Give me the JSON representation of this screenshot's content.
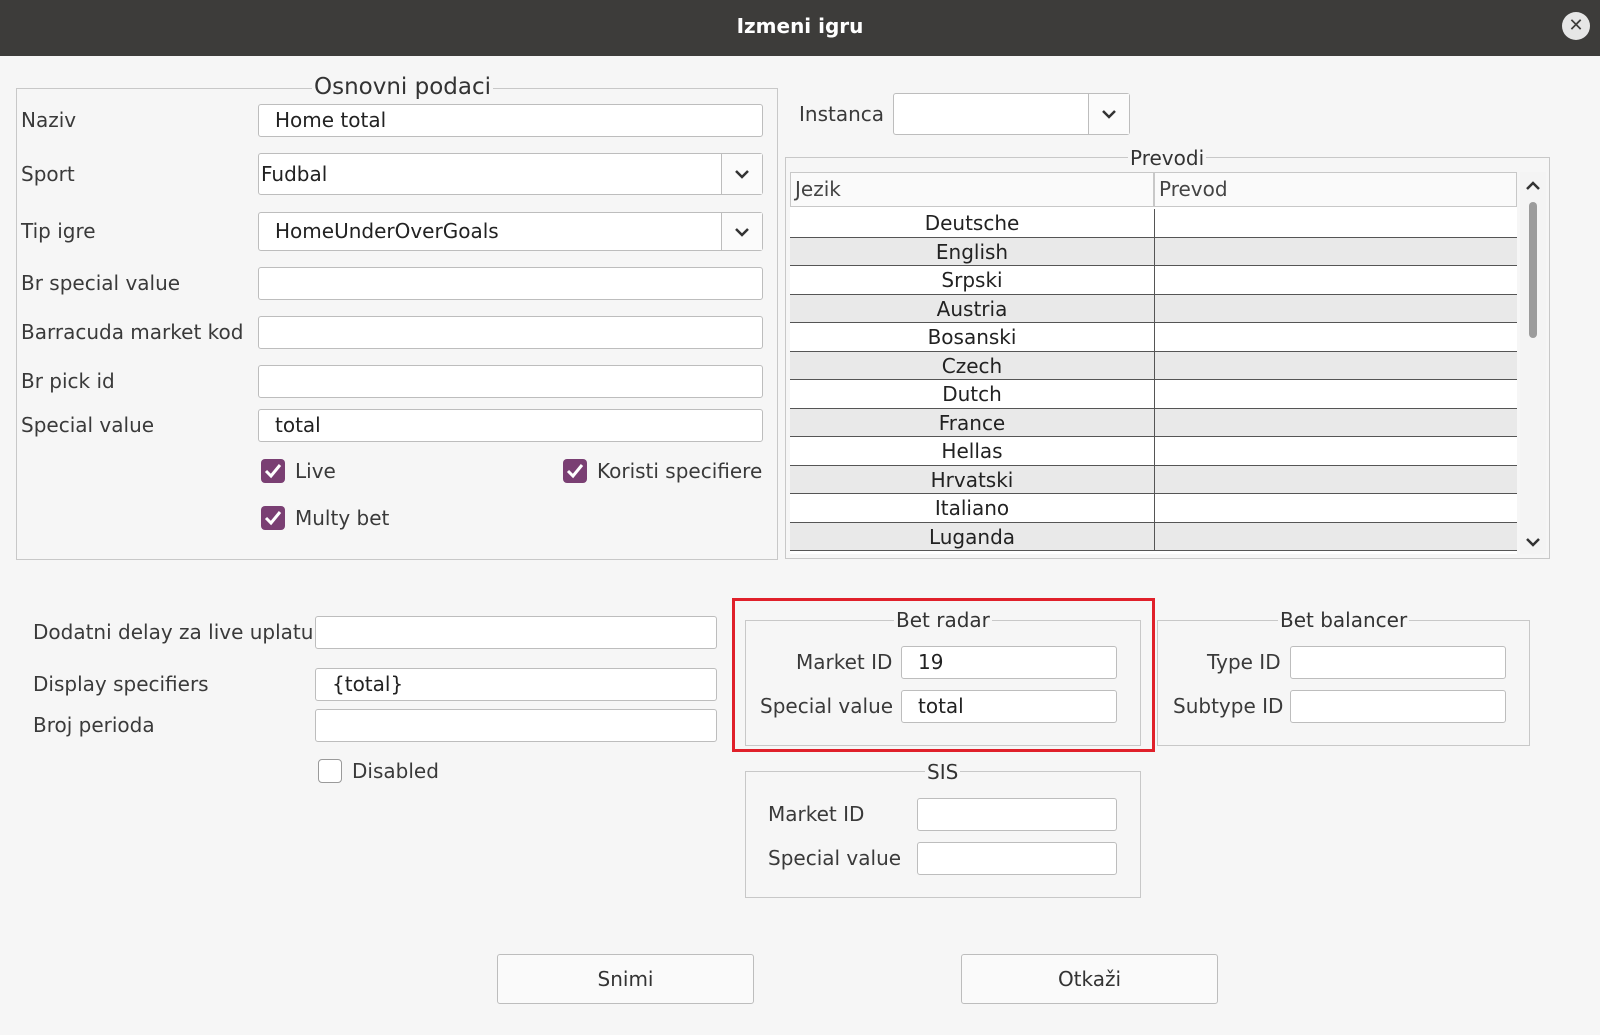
{
  "window": {
    "title": "Izmeni igru",
    "close_icon": "close-icon"
  },
  "basic": {
    "legend": "Osnovni podaci",
    "naziv": {
      "label": "Naziv",
      "value": "Home total"
    },
    "sport": {
      "label": "Sport",
      "value": "Fudbal"
    },
    "tip_igre": {
      "label": "Tip igre",
      "value": "HomeUnderOverGoals"
    },
    "br_special_value": {
      "label": "Br special value",
      "value": ""
    },
    "barracuda_market_kod": {
      "label": "Barracuda market kod",
      "value": ""
    },
    "br_pick_id": {
      "label": "Br pick id",
      "value": ""
    },
    "special_value": {
      "label": "Special value",
      "value": "total"
    },
    "live": {
      "label": "Live",
      "checked": true
    },
    "koristi_specifiere": {
      "label": "Koristi specifiere",
      "checked": true
    },
    "multy_bet": {
      "label": "Multy bet",
      "checked": true
    }
  },
  "instanca": {
    "label": "Instanca",
    "value": ""
  },
  "prevodi": {
    "legend": "Prevodi",
    "columns": [
      "Jezik",
      "Prevod"
    ],
    "rows": [
      {
        "jezik": "Deutsche",
        "prevod": ""
      },
      {
        "jezik": "English",
        "prevod": ""
      },
      {
        "jezik": "Srpski",
        "prevod": ""
      },
      {
        "jezik": "Austria",
        "prevod": ""
      },
      {
        "jezik": "Bosanski",
        "prevod": ""
      },
      {
        "jezik": "Czech",
        "prevod": ""
      },
      {
        "jezik": "Dutch",
        "prevod": ""
      },
      {
        "jezik": "France",
        "prevod": ""
      },
      {
        "jezik": "Hellas",
        "prevod": ""
      },
      {
        "jezik": "Hrvatski",
        "prevod": ""
      },
      {
        "jezik": "Italiano",
        "prevod": ""
      },
      {
        "jezik": "Luganda",
        "prevod": ""
      }
    ]
  },
  "extra": {
    "dodatni_delay": {
      "label": "Dodatni delay za live uplatu",
      "value": ""
    },
    "display_specifiers": {
      "label": "Display specifiers",
      "value": "{total}"
    },
    "broj_perioda": {
      "label": "Broj perioda",
      "value": ""
    },
    "disabled": {
      "label": "Disabled",
      "checked": false
    }
  },
  "bet_radar": {
    "legend": "Bet radar",
    "market_id": {
      "label": "Market ID",
      "value": "19"
    },
    "special_value": {
      "label": "Special value",
      "value": "total"
    }
  },
  "bet_balancer": {
    "legend": "Bet balancer",
    "type_id": {
      "label": "Type ID",
      "value": ""
    },
    "subtype_id": {
      "label": "Subtype ID",
      "value": ""
    }
  },
  "sis": {
    "legend": "SIS",
    "market_id": {
      "label": "Market ID",
      "value": ""
    },
    "special_value": {
      "label": "Special value",
      "value": ""
    }
  },
  "buttons": {
    "save": "Snimi",
    "cancel": "Otkaži"
  },
  "colors": {
    "titlebar": "#3d3c3a",
    "checkbox": "#7a3f73",
    "highlight": "#e0202a"
  }
}
